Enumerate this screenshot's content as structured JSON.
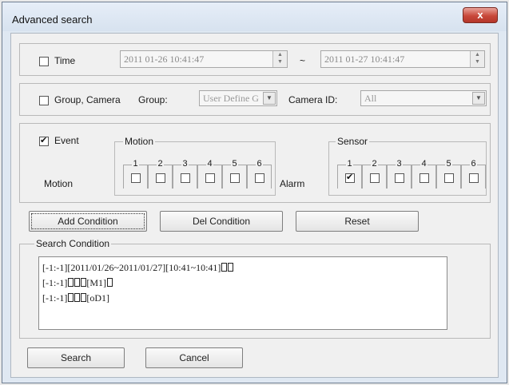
{
  "window": {
    "title": "Advanced search",
    "close_label": "x"
  },
  "time": {
    "label": "Time",
    "checked": false,
    "from": "2011 01-26 10:41:47",
    "separator": "~",
    "to": "2011 01-27 10:41:47"
  },
  "group_camera": {
    "label": "Group, Camera",
    "checked": false,
    "group_label": "Group:",
    "group_value": "User Define G",
    "camera_label": "Camera ID:",
    "camera_value": "All"
  },
  "event": {
    "label": "Event",
    "checked": true,
    "motion_group_label": "Motion",
    "motion_row_label": "Motion",
    "motion_channels": [
      {
        "n": "1",
        "checked": false
      },
      {
        "n": "2",
        "checked": false
      },
      {
        "n": "3",
        "checked": false
      },
      {
        "n": "4",
        "checked": false
      },
      {
        "n": "5",
        "checked": false
      },
      {
        "n": "6",
        "checked": false
      }
    ],
    "alarm_label": "Alarm",
    "sensor_group_label": "Sensor",
    "sensor_channels": [
      {
        "n": "1",
        "checked": true
      },
      {
        "n": "2",
        "checked": false
      },
      {
        "n": "3",
        "checked": false
      },
      {
        "n": "4",
        "checked": false
      },
      {
        "n": "5",
        "checked": false
      },
      {
        "n": "6",
        "checked": false
      }
    ]
  },
  "buttons": {
    "add_condition": "Add Condition",
    "del_condition": "Del Condition",
    "reset": "Reset",
    "search": "Search",
    "cancel": "Cancel"
  },
  "search_condition": {
    "label": "Search Condition",
    "rows": [
      {
        "text": "[-1:-1][2011/01/26~2011/01/27][10:41~10:41]",
        "boxes": 2
      },
      {
        "text": "[-1:-1]",
        "boxes": 3,
        "suffix": "[M1]",
        "suffix_boxes": 1
      },
      {
        "text": "[-1:-1]",
        "boxes": 3,
        "suffix": "[oD1]",
        "suffix_boxes": 0
      }
    ]
  }
}
